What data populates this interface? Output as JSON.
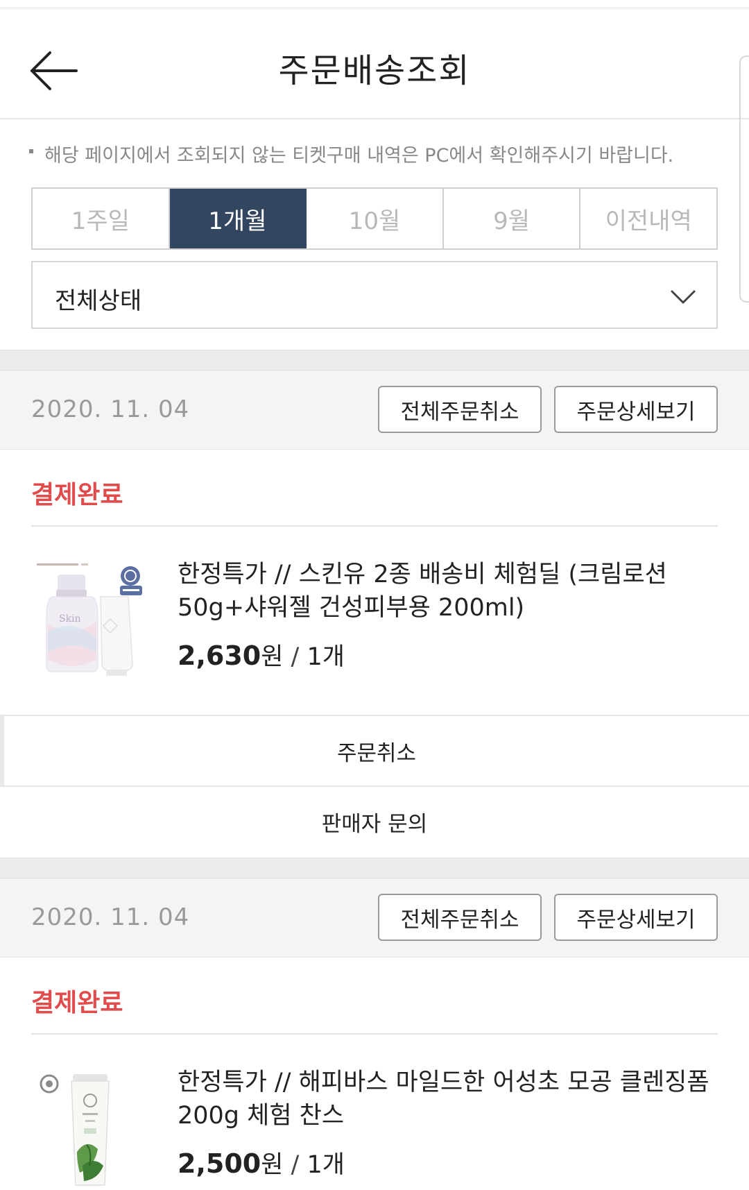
{
  "header": {
    "title": "주문배송조회"
  },
  "notice": "해당 페이지에서 조회되지 않는 티켓구매 내역은 PC에서 확인해주시기 바랍니다.",
  "period_tabs": [
    {
      "label": "1주일",
      "active": false
    },
    {
      "label": "1개월",
      "active": true
    },
    {
      "label": "10월",
      "active": false
    },
    {
      "label": "9월",
      "active": false
    },
    {
      "label": "이전내역",
      "active": false
    }
  ],
  "status_filter": {
    "selected": "전체상태"
  },
  "orders": [
    {
      "date": "2020. 11. 04",
      "cancel_all_label": "전체주문취소",
      "detail_label": "주문상세보기",
      "pay_status": "결제완료",
      "product": {
        "name": "한정특가 // 스킨유 2종 배송비 체험딜 (크림로션50g+샤워젤 건성피부용 200ml)",
        "price": "2,630",
        "currency": "원",
        "quantity": "1개"
      },
      "actions": {
        "cancel": "주문취소",
        "inquiry": "판매자 문의"
      }
    },
    {
      "date": "2020. 11. 04",
      "cancel_all_label": "전체주문취소",
      "detail_label": "주문상세보기",
      "pay_status": "결제완료",
      "product": {
        "name": "한정특가 // 해피바스 마일드한 어성초 모공 클렌징폼 200g 체험 찬스",
        "price": "2,500",
        "currency": "원",
        "quantity": "1개"
      }
    }
  ],
  "colors": {
    "active_tab": "#334660",
    "pay_status": "#e14b4b",
    "section_gap": "#ececec",
    "order_header_bg": "#f4f4f4"
  }
}
